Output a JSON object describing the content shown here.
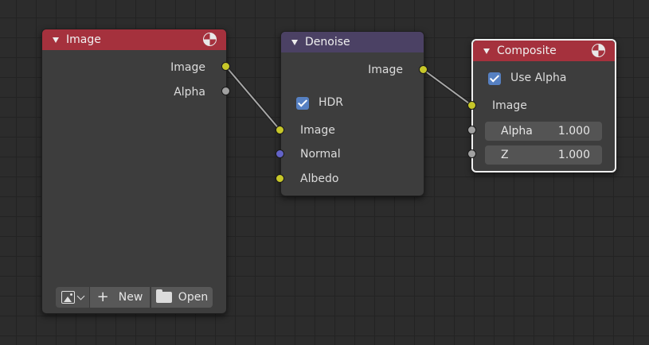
{
  "colors": {
    "socket_color": "#c7c729",
    "socket_float": "#a1a1a1",
    "socket_vector": "#6363c7",
    "link": "#a8a8a8",
    "header_output": "#a5313d",
    "header_filter": "#4b4164"
  },
  "nodes": {
    "image": {
      "title": "Image",
      "icon": "render-icon",
      "outputs": [
        "Image",
        "Alpha"
      ],
      "buttons": {
        "browse_icon": "image-icon",
        "new_label": "New",
        "open_label": "Open"
      }
    },
    "denoise": {
      "title": "Denoise",
      "outputs": [
        "Image"
      ],
      "hdr_label": "HDR",
      "hdr_checked": true,
      "inputs": [
        "Image",
        "Normal",
        "Albedo"
      ]
    },
    "composite": {
      "title": "Composite",
      "icon": "render-icon",
      "use_alpha_label": "Use Alpha",
      "use_alpha_checked": true,
      "inputs": {
        "image": "Image",
        "alpha_label": "Alpha",
        "alpha_value": "1.000",
        "z_label": "Z",
        "z_value": "1.000"
      }
    }
  }
}
